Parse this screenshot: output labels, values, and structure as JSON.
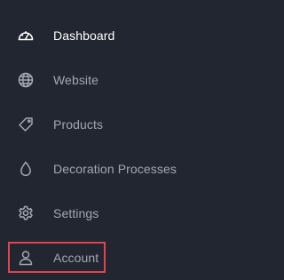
{
  "sidebar": {
    "items": [
      {
        "label": "Dashboard",
        "icon": "dashboard-gauge-icon",
        "active": true
      },
      {
        "label": "Website",
        "icon": "globe-icon",
        "active": false
      },
      {
        "label": "Products",
        "icon": "tag-icon",
        "active": false
      },
      {
        "label": "Decoration Processes",
        "icon": "droplet-icon",
        "active": false
      },
      {
        "label": "Settings",
        "icon": "gear-icon",
        "active": false
      },
      {
        "label": "Account",
        "icon": "user-icon",
        "active": false
      }
    ]
  },
  "colors": {
    "background": "#222630",
    "label": "#a2a7b2",
    "active_label": "#ffffff",
    "highlight_border": "#e04451"
  }
}
